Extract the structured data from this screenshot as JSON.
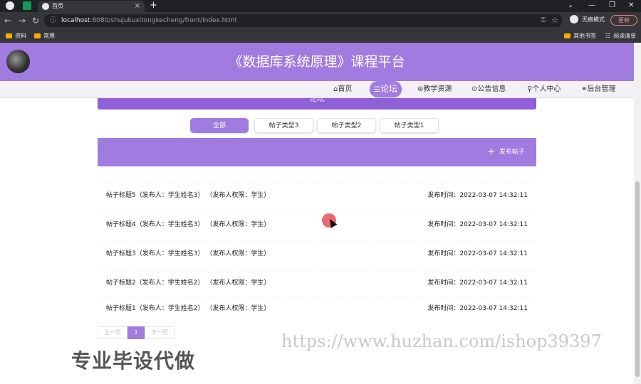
{
  "browser": {
    "tab_title": "首页",
    "tab_close": "×",
    "new_tab": "+",
    "win_controls": [
      "⌄",
      "—",
      "❐",
      "✕"
    ],
    "url_host": "localhost",
    "url_rest": ":8080/shujukuxitongkecheng/front/index.html",
    "incognito_label": "无痕模式",
    "update_label": "更新",
    "nav": {
      "back": "←",
      "forward": "→",
      "reload": "↻"
    },
    "bookmarks": [
      "资料",
      "常用"
    ],
    "bookmarks_right": [
      "其他书签",
      "阅读清单"
    ]
  },
  "site": {
    "title": "《数据库系统原理》课程平台",
    "nav": [
      {
        "label": "⌂首页"
      },
      {
        "label": "论坛"
      },
      {
        "label": "教学资源"
      },
      {
        "label": "公告信息"
      },
      {
        "label": "个人中心"
      },
      {
        "label": "后台管理"
      }
    ],
    "banner": "论坛",
    "filters": [
      "全部",
      "帖子类型3",
      "帖子类型2",
      "帖子类型1"
    ],
    "post_button": "发布帖子",
    "posts": [
      {
        "title": "帖子标题5（发布人：学生姓名3） （发布人权限：学生）",
        "date": "发布时间：2022-03-07 14:32:11"
      },
      {
        "title": "帖子标题4（发布人：学生姓名3） （发布人权限：学生）",
        "date": "发布时间：2022-03-07 14:32:11"
      },
      {
        "title": "帖子标题3（发布人：学生姓名3） （发布人权限：学生）",
        "date": "发布时间：2022-03-07 14:32:11"
      },
      {
        "title": "帖子标题2（发布人：学生姓名2） （发布人权限：学生）",
        "date": "发布时间：2022-03-07 14:32:11"
      },
      {
        "title": "帖子标题1（发布人：学生姓名2） （发布人权限：学生）",
        "date": "发布时间：2022-03-07 14:32:11"
      }
    ],
    "pager": {
      "prev": "上一页",
      "current": "1",
      "next": "下一页"
    }
  },
  "overlay": {
    "watermark_text": "专业毕设代做",
    "watermark_url": "https://www.huzhan.com/ishop39397"
  }
}
